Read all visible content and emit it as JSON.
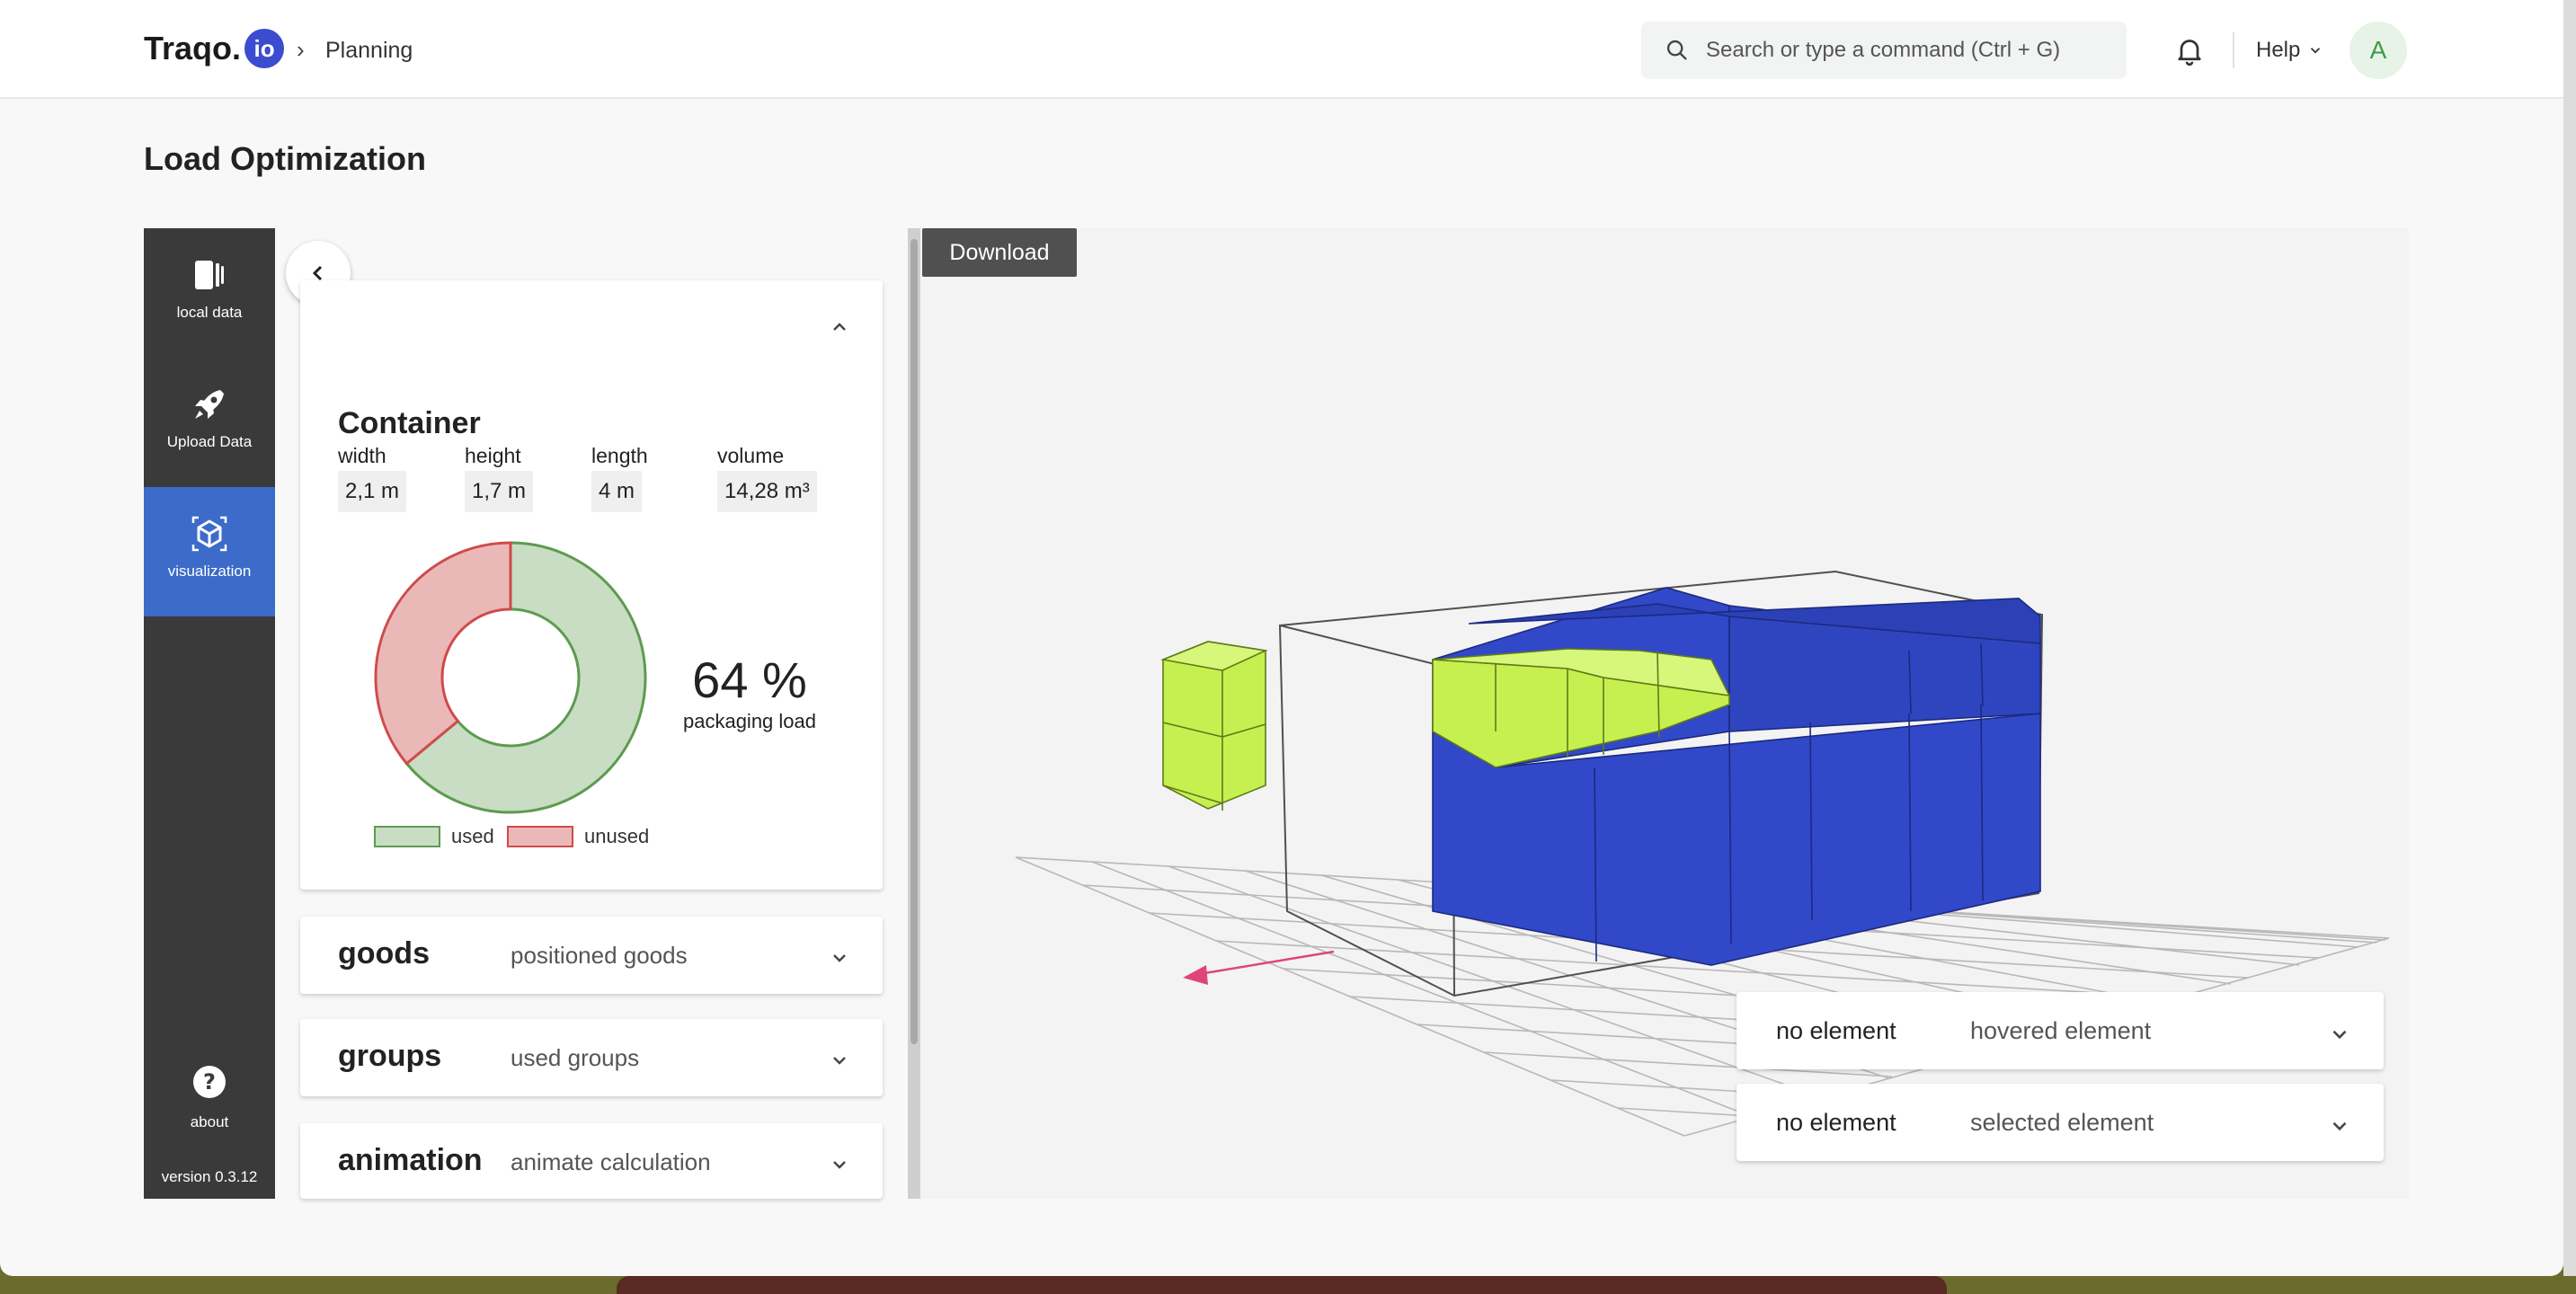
{
  "header": {
    "logo_text": "Traqo.",
    "logo_badge": "io",
    "breadcrumb": "Planning",
    "search_placeholder": "Search or type a command (Ctrl + G)",
    "help_label": "Help",
    "avatar_initial": "A"
  },
  "page": {
    "title": "Load Optimization"
  },
  "sidebar": {
    "items": [
      {
        "label": "local data",
        "icon": "local-data-icon"
      },
      {
        "label": "Upload Data",
        "icon": "rocket-icon"
      },
      {
        "label": "visualization",
        "icon": "cube-icon",
        "active": true
      }
    ],
    "about_label": "about",
    "version": "version 0.3.12"
  },
  "container": {
    "title": "Container",
    "width_label": "width",
    "width_value": "2,1 m",
    "height_label": "height",
    "height_value": "1,7 m",
    "length_label": "length",
    "length_value": "4 m",
    "volume_label": "volume",
    "volume_value": "14,28 m³",
    "load_percent": "64 %",
    "load_label": "packaging load",
    "used_fraction": 0.64,
    "legend_used": "used",
    "legend_unused": "unused",
    "colors": {
      "used": "#c8ddc4",
      "used_stroke": "#5d9b4f",
      "unused": "#ebb8b8",
      "unused_stroke": "#cf4b4b"
    }
  },
  "accordions": [
    {
      "title": "goods",
      "subtitle": "positioned goods"
    },
    {
      "title": "groups",
      "subtitle": "used groups"
    },
    {
      "title": "animation",
      "subtitle": "animate calculation"
    }
  ],
  "viewer": {
    "download_label": "Download",
    "hovered": {
      "value": "no element",
      "label": "hovered element"
    },
    "selected": {
      "value": "no element",
      "label": "selected element"
    },
    "colors": {
      "goods_blue": "#3148c9",
      "goods_lime": "#c6f04f"
    }
  }
}
